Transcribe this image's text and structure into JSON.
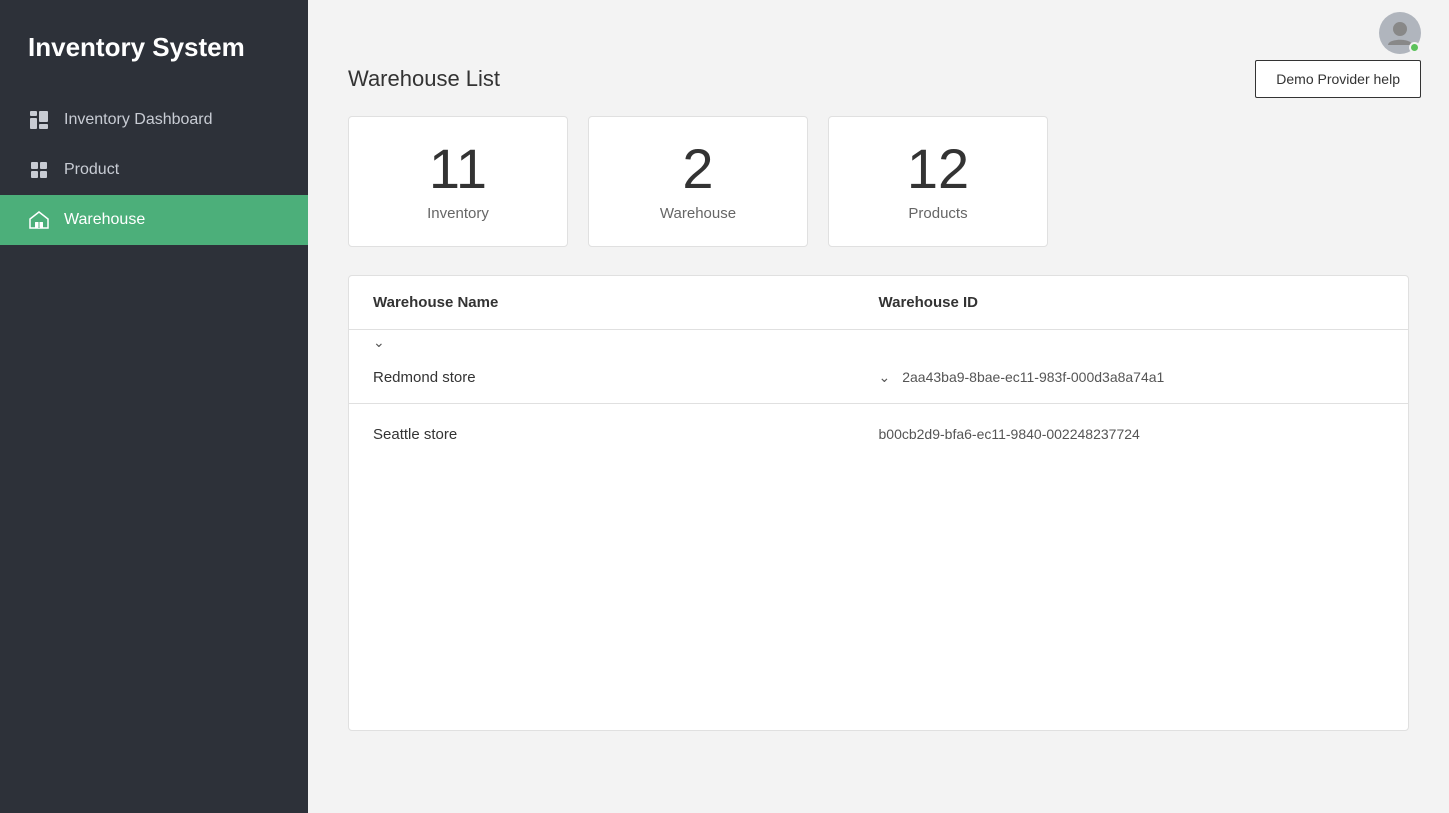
{
  "app": {
    "title": "Inventory System"
  },
  "sidebar": {
    "items": [
      {
        "id": "inventory-dashboard",
        "label": "Inventory Dashboard",
        "icon": "dashboard-icon",
        "active": false
      },
      {
        "id": "product",
        "label": "Product",
        "icon": "product-icon",
        "active": false
      },
      {
        "id": "warehouse",
        "label": "Warehouse",
        "icon": "warehouse-icon",
        "active": true
      }
    ]
  },
  "header": {
    "demo_btn_label": "Demo Provider help"
  },
  "main": {
    "page_title": "Warehouse List",
    "stats": [
      {
        "id": "inventory-stat",
        "number": "11",
        "label": "Inventory"
      },
      {
        "id": "warehouse-stat",
        "number": "2",
        "label": "Warehouse"
      },
      {
        "id": "products-stat",
        "number": "12",
        "label": "Products"
      }
    ],
    "table": {
      "col_name": "Warehouse Name",
      "col_id": "Warehouse ID",
      "rows": [
        {
          "name": "Redmond store",
          "id": "2aa43ba9-8bae-ec11-983f-000d3a8a74a1"
        },
        {
          "name": "Seattle store",
          "id": "b00cb2d9-bfa6-ec11-9840-002248237724"
        }
      ]
    }
  }
}
